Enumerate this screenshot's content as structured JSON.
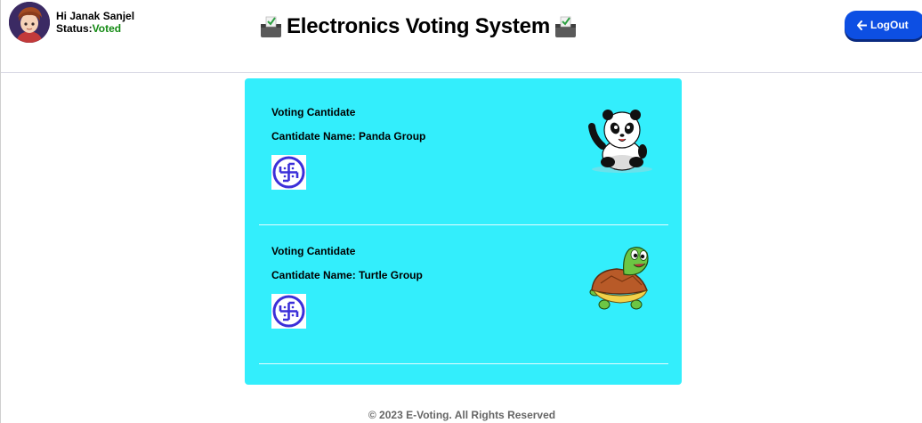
{
  "header": {
    "greeting": "Hi Janak Sanjel",
    "status_label": "Status:",
    "status_value": "Voted",
    "title": "Electronics Voting System",
    "logout_label": "LogOut"
  },
  "candidates": [
    {
      "heading": "Voting Cantidate",
      "name_label": "Cantidate Name:",
      "name": "Panda Group",
      "mascot": "panda"
    },
    {
      "heading": "Voting Cantidate",
      "name_label": "Cantidate Name:",
      "name": "Turtle Group",
      "mascot": "turtle"
    }
  ],
  "footer": {
    "text": "© 2023 E-Voting. All Rights Reserved"
  },
  "colors": {
    "card_background": "#33eefc",
    "logout_button": "#0d4fe3",
    "status_voted": "#138a13",
    "symbol_blue": "#3b2fd9"
  },
  "icons": {
    "title": "ballot-box-icon",
    "logout": "arrow-left-icon",
    "symbol": "swastika-symbol-icon"
  }
}
